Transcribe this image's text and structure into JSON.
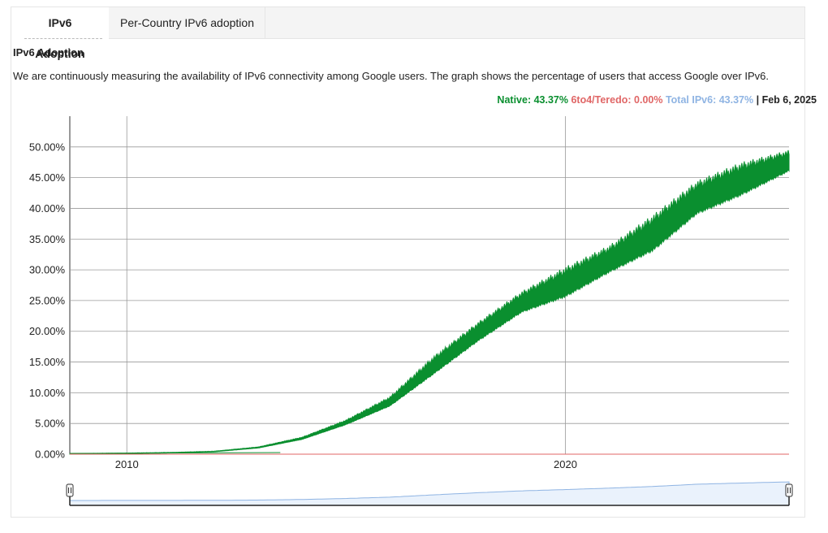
{
  "tabs": [
    {
      "label": "IPv6 Adoption",
      "active": true
    },
    {
      "label": "Per-Country IPv6 adoption",
      "active": false
    }
  ],
  "section": {
    "title": "IPv6 Adoption",
    "description": "We are continuously measuring the availability of IPv6 connectivity among Google users. The graph shows the percentage of users that access Google over IPv6."
  },
  "legend": {
    "native": "Native: 43.37%",
    "teredo": "6to4/Teredo: 0.00%",
    "total": "Total IPv6: 43.37%",
    "separator": "|",
    "date": "Feb 6, 2025"
  },
  "colors": {
    "native": "#0a8f2f",
    "teredo": "#e06666",
    "total": "#8fb4e3",
    "grid": "#9a9a9a"
  },
  "chart_data": {
    "type": "area",
    "title": "IPv6 Adoption",
    "xlabel": "",
    "ylabel": "",
    "x_ticks": [
      "2010",
      "2020"
    ],
    "y_ticks": [
      "0.00%",
      "5.00%",
      "10.00%",
      "15.00%",
      "20.00%",
      "25.00%",
      "30.00%",
      "35.00%",
      "40.00%",
      "45.00%",
      "50.00%"
    ],
    "ylim": [
      0,
      50
    ],
    "xlim": [
      2008.7,
      2025.1
    ],
    "grid": true,
    "series": [
      {
        "name": "Native",
        "x": [
          2008.7,
          2010,
          2011,
          2012,
          2013,
          2014,
          2015,
          2016,
          2017,
          2018,
          2019,
          2020,
          2021,
          2022,
          2023,
          2024,
          2025.1
        ],
        "low": [
          0.0,
          0.1,
          0.2,
          0.4,
          1.0,
          2.4,
          4.8,
          7.8,
          13.0,
          18.3,
          23.0,
          25.5,
          29.5,
          33.0,
          39.0,
          42.0,
          46.0
        ],
        "high": [
          0.1,
          0.2,
          0.3,
          0.5,
          1.2,
          2.8,
          5.6,
          9.4,
          16.0,
          21.5,
          26.5,
          30.5,
          34.0,
          39.0,
          44.5,
          47.5,
          49.5
        ]
      },
      {
        "name": "6to4/Teredo",
        "x": [
          2008.7,
          2025.1
        ],
        "values": [
          0.0,
          0.0
        ]
      }
    ]
  }
}
